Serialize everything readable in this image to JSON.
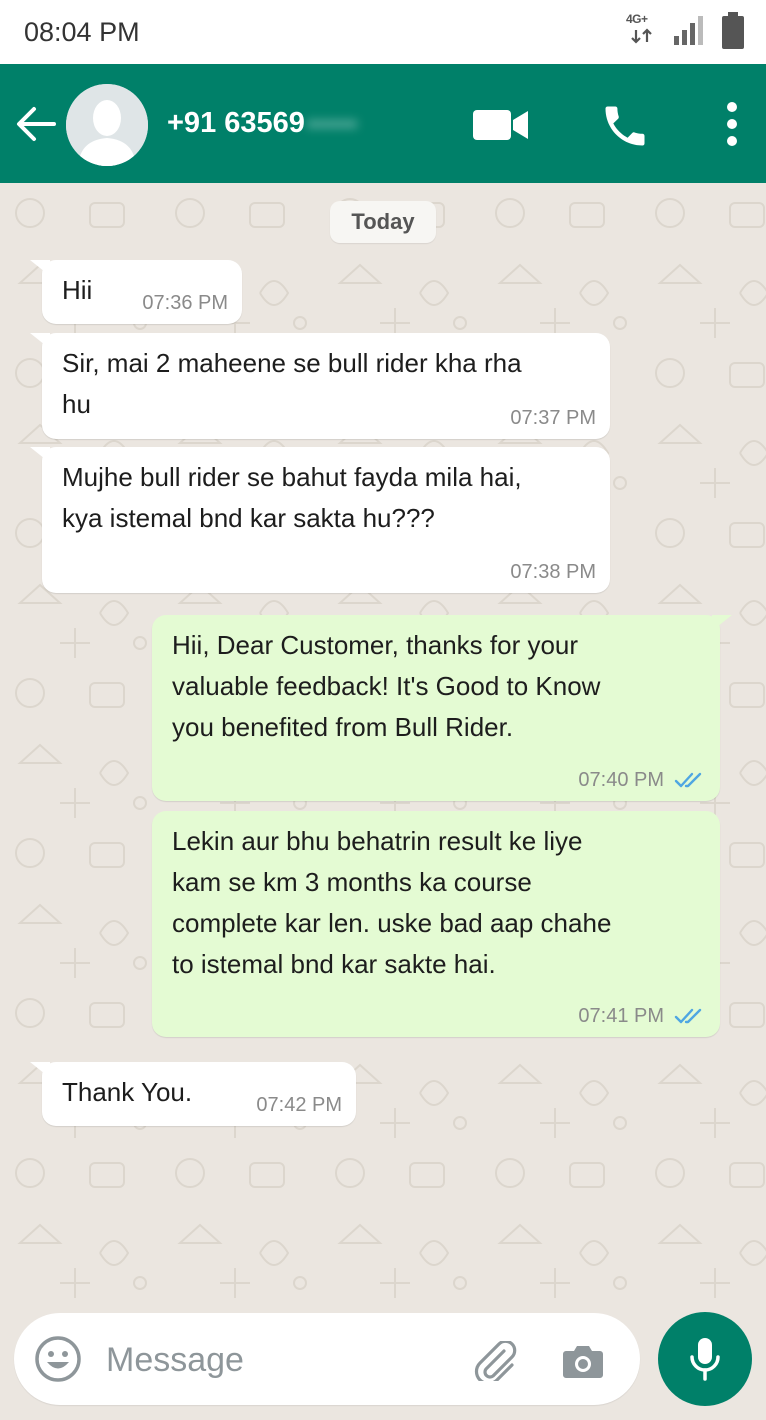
{
  "status_bar": {
    "time": "08:04 PM",
    "network": "4G+",
    "icons": [
      "data-arrows-icon",
      "signal-icon",
      "battery-icon"
    ]
  },
  "header": {
    "contact_number": "+91 63569",
    "contact_number_hidden": "••••••",
    "icons": [
      "back-arrow-icon",
      "avatar-icon",
      "video-call-icon",
      "phone-icon",
      "more-vert-icon"
    ]
  },
  "chat": {
    "date_label": "Today",
    "messages": [
      {
        "direction": "incoming",
        "text": "Hii",
        "time": "07:36 PM"
      },
      {
        "direction": "incoming",
        "text_lines": [
          "Sir, mai 2 maheene se bull rider kha rha",
          "hu"
        ],
        "time": "07:37 PM"
      },
      {
        "direction": "incoming",
        "text_lines": [
          "Mujhe bull rider se bahut fayda mila hai,",
          "kya istemal bnd kar sakta hu???"
        ],
        "time": "07:38 PM"
      },
      {
        "direction": "outgoing",
        "text_lines": [
          "Hii, Dear Customer, thanks for your",
          "valuable feedback! It's Good to Know",
          "you benefited from Bull Rider."
        ],
        "time": "07:40 PM",
        "status": "read"
      },
      {
        "direction": "outgoing",
        "text_lines": [
          "Lekin aur bhu behatrin result ke liye",
          "kam se km 3 months ka course",
          "complete kar len. uske bad aap chahe",
          "to istemal bnd kar sakte hai."
        ],
        "time": "07:41 PM",
        "status": "read"
      },
      {
        "direction": "incoming",
        "text": "Thank You.",
        "time": "07:42 PM"
      }
    ]
  },
  "input_bar": {
    "placeholder": "Message",
    "icons": [
      "emoji-icon",
      "attach-icon",
      "camera-icon",
      "mic-icon"
    ]
  },
  "colors": {
    "header": "#008069",
    "incoming_bubble": "#ffffff",
    "outgoing_bubble": "#e4fbd3",
    "chat_background": "#ebe6e0",
    "read_tick": "#4fa6e2"
  }
}
